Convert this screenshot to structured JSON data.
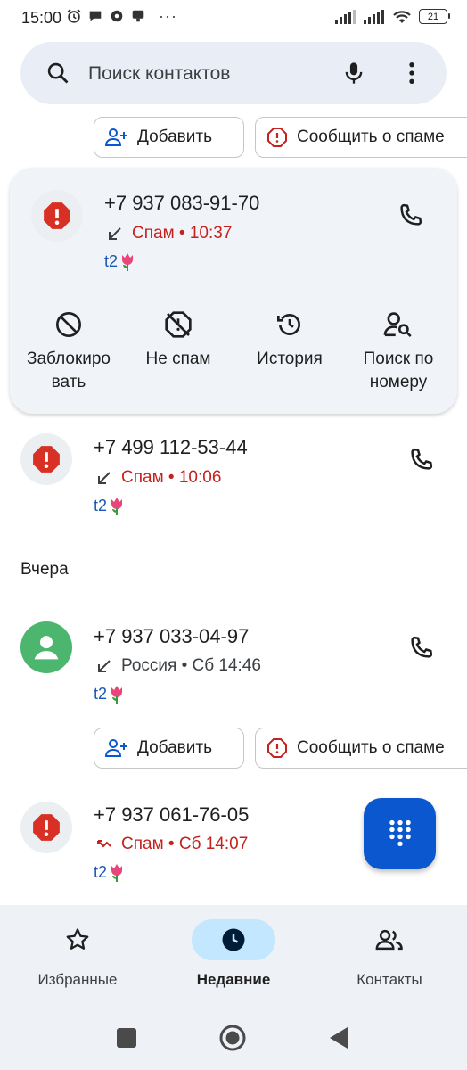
{
  "status_bar": {
    "time": "15:00",
    "battery": "21",
    "more": "···"
  },
  "search": {
    "placeholder": "Поиск контактов",
    "icons": [
      "search-icon",
      "mic-icon",
      "more-vert-icon"
    ]
  },
  "chips": {
    "add_label": "Добавить",
    "report_label": "Сообщить о спаме"
  },
  "calls": [
    {
      "number": "+7 937 083-91-70",
      "status": "Спам • 10:37",
      "carrier": "t2",
      "type": "spam",
      "direction": "incoming"
    },
    {
      "number": "+7 499 112-53-44",
      "status": "Спам • 10:06",
      "carrier": "t2",
      "type": "spam",
      "direction": "incoming"
    },
    {
      "number": "+7 937 033-04-97",
      "status": "Россия • Сб 14:46",
      "carrier": "t2",
      "type": "contact",
      "direction": "incoming"
    },
    {
      "number": "+7 937 061-76-05",
      "status": "Спам • Сб 14:07",
      "carrier": "t2",
      "type": "spam",
      "direction": "missed"
    }
  ],
  "actions": {
    "block_line1": "Заблокиро",
    "block_line2": "вать",
    "not_spam": "Не спам",
    "history": "История",
    "lookup_line1": "Поиск по",
    "lookup_line2": "номеру"
  },
  "section_yesterday": "Вчера",
  "nav": {
    "favorites": "Избранные",
    "recents": "Недавние",
    "contacts": "Контакты",
    "active": "recents"
  },
  "colors": {
    "spam_red": "#c5221f",
    "accent_blue": "#0b57d0",
    "carrier_blue": "#1a56b8",
    "active_pill": "#c2e7ff",
    "card_bg": "#f0f4f9"
  }
}
